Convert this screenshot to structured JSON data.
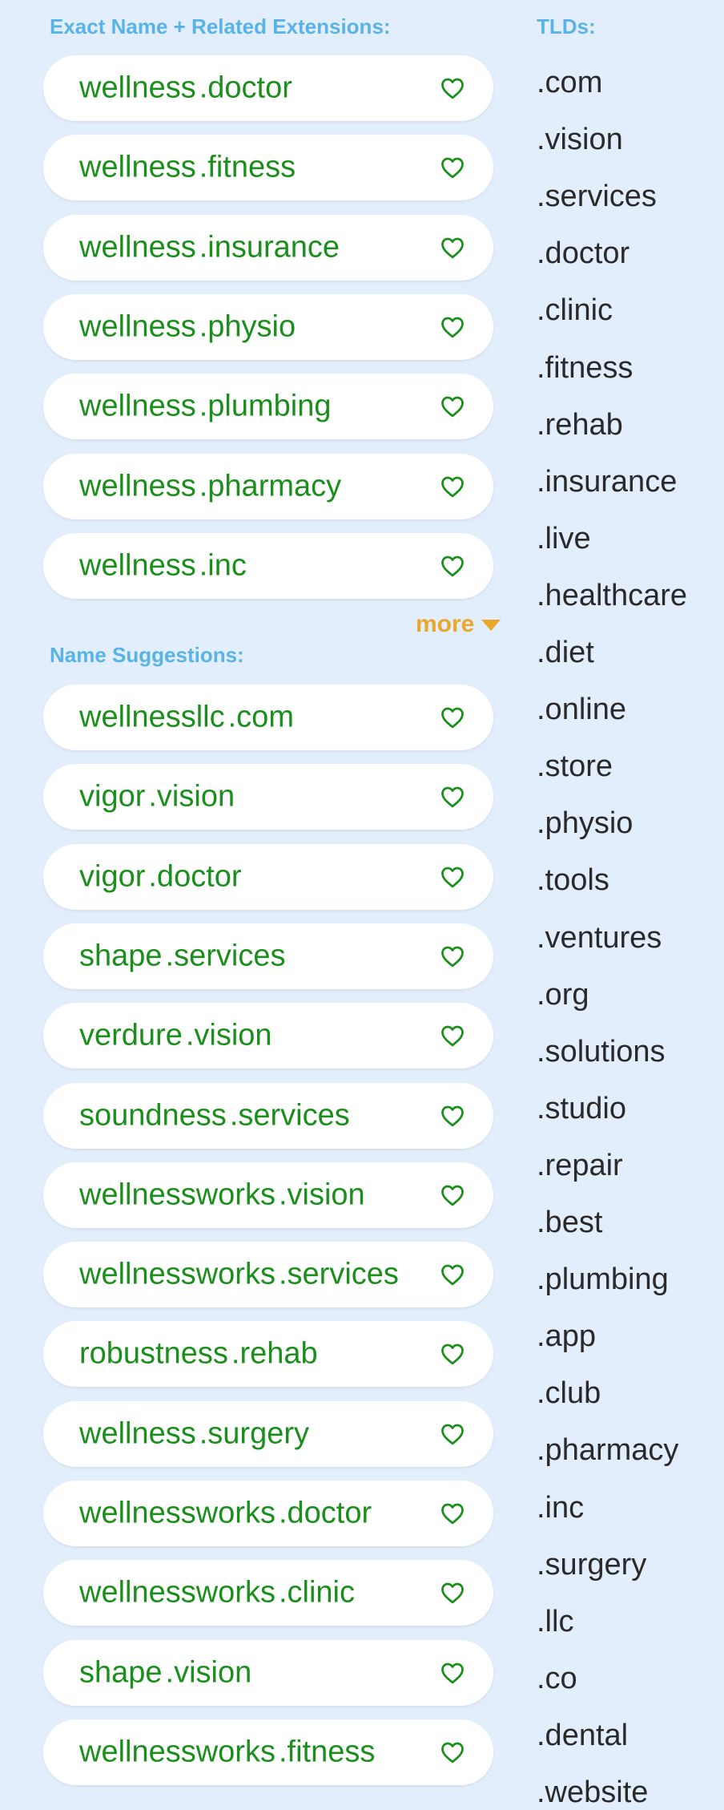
{
  "exact": {
    "heading": "Exact Name + Related Extensions:",
    "items": [
      {
        "name": "wellness",
        "tld": ".doctor"
      },
      {
        "name": "wellness",
        "tld": ".fitness"
      },
      {
        "name": "wellness",
        "tld": ".insurance"
      },
      {
        "name": "wellness",
        "tld": ".physio"
      },
      {
        "name": "wellness",
        "tld": ".plumbing"
      },
      {
        "name": "wellness",
        "tld": ".pharmacy"
      },
      {
        "name": "wellness",
        "tld": ".inc"
      }
    ],
    "more_label": "more"
  },
  "suggestions": {
    "heading": "Name Suggestions:",
    "items": [
      {
        "name": "wellnessllc",
        "tld": ".com"
      },
      {
        "name": "vigor",
        "tld": ".vision"
      },
      {
        "name": "vigor",
        "tld": ".doctor"
      },
      {
        "name": "shape",
        "tld": ".services"
      },
      {
        "name": "verdure",
        "tld": ".vision"
      },
      {
        "name": "soundness",
        "tld": ".services"
      },
      {
        "name": "wellnessworks",
        "tld": ".vision"
      },
      {
        "name": "wellnessworks",
        "tld": ".services"
      },
      {
        "name": "robustness",
        "tld": ".rehab"
      },
      {
        "name": "wellness",
        "tld": ".surgery"
      },
      {
        "name": "wellnessworks",
        "tld": ".doctor"
      },
      {
        "name": "wellnessworks",
        "tld": ".clinic"
      },
      {
        "name": "shape",
        "tld": ".vision"
      },
      {
        "name": "wellnessworks",
        "tld": ".fitness"
      }
    ]
  },
  "tlds": {
    "heading": "TLDs:",
    "items": [
      ".com",
      ".vision",
      ".services",
      ".doctor",
      ".clinic",
      ".fitness",
      ".rehab",
      ".insurance",
      ".live",
      ".healthcare",
      ".diet",
      ".online",
      ".store",
      ".physio",
      ".tools",
      ".ventures",
      ".org",
      ".solutions",
      ".studio",
      ".repair",
      ".best",
      ".plumbing",
      ".app",
      ".club",
      ".pharmacy",
      ".inc",
      ".surgery",
      ".llc",
      ".co",
      ".dental",
      ".website"
    ]
  },
  "colors": {
    "background": "#e3eefd",
    "domain_text": "#1b8f1b",
    "heading": "#59b3e6",
    "more": "#e9a72c",
    "tld_text": "#2a2a2a"
  },
  "icons": {
    "favorite": "heart-outline-icon",
    "more": "caret-down-icon"
  }
}
